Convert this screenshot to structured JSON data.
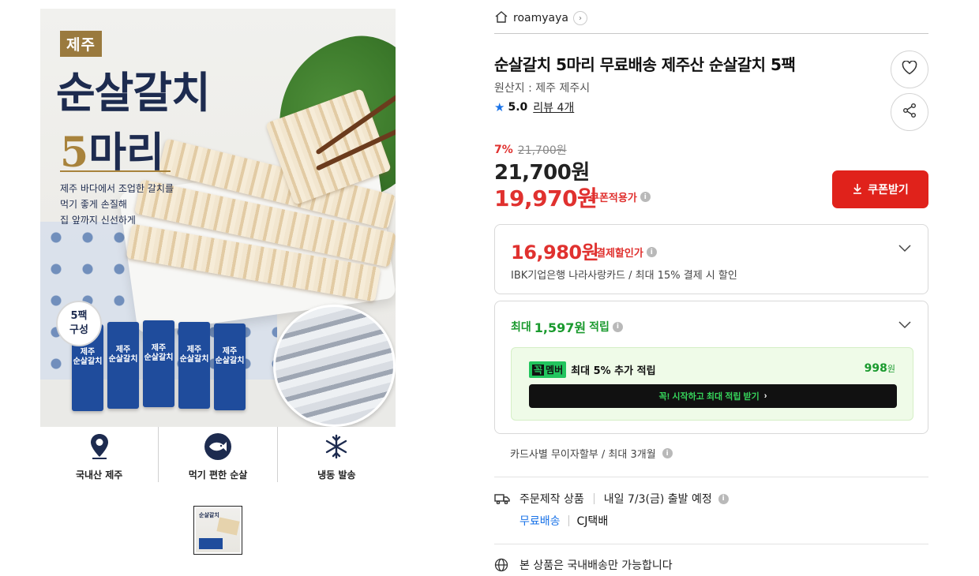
{
  "image": {
    "badge": "제주",
    "headline": "순살갈치",
    "count_number": "5",
    "count_unit": "마리",
    "desc": [
      "제주 바다에서 조업한 갈치를",
      "먹기 좋게 손질해",
      "집 앞까지 신선하게"
    ],
    "pack_badge_line1": "5팩",
    "pack_badge_line2": "구성",
    "pack_label_line1": "제주",
    "pack_label_line2": "순살갈치",
    "features": [
      {
        "icon": "location-pin-icon",
        "label": "국내산 제주"
      },
      {
        "icon": "fish-icon",
        "label": "먹기 편한 순살"
      },
      {
        "icon": "snowflake-icon",
        "label": "냉동 발송"
      }
    ],
    "thumb_text": "순살갈치"
  },
  "store": {
    "name": "roamyaya"
  },
  "product": {
    "title": "순살갈치 5마리 무료배송 제주산 순살갈치 5팩",
    "origin": "원산지 : 제주 제주시",
    "rating": "5.0",
    "reviews": "리뷰 4개"
  },
  "price": {
    "discount_rate": "7%",
    "original": "21,700원",
    "sale": "21,700원",
    "coupon_price": "19,970원",
    "coupon_label": "쿠폰적용가",
    "coupon_button": "쿠폰받기"
  },
  "payment": {
    "price": "16,980원",
    "label": "결제할인가",
    "sub": "IBK기업은행 나라사랑카드 / 최대 15% 결제 시 할인"
  },
  "points": {
    "title_prefix": "최대",
    "title_value": "1,597원",
    "title_suffix": "적립",
    "member_badge_dark": "꼭",
    "member_badge": "멤버",
    "member_text": "최대 5% 추가 적립",
    "member_amount": "998",
    "member_amount_unit": "원",
    "member_button": "꼭! 시작하고 최대 적립 받기"
  },
  "installment": "카드사별 무이자할부 / 최대 3개월",
  "shipping": {
    "type": "주문제작 상품",
    "schedule": "내일 7/3(금) 출발 예정",
    "fee": "무료배송",
    "carrier": "CJ택배",
    "domestic_only": "본 상품은 국내배송만 가능합니다"
  },
  "colors": {
    "accent_red": "#e0221b",
    "point_green": "#1a9a2e",
    "free_ship_blue": "#1a73e8"
  }
}
